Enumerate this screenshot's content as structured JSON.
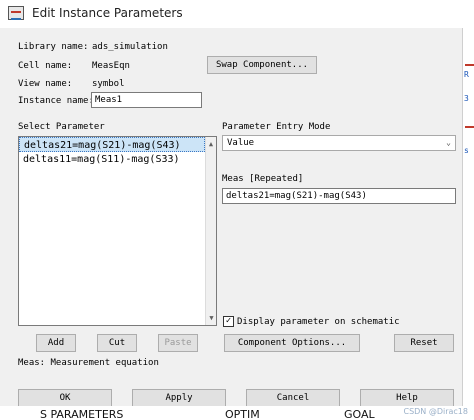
{
  "window": {
    "title": "Edit Instance Parameters",
    "icon": "ads-schematic-icon"
  },
  "info": {
    "library_label": "Library name:",
    "library_value": "ads_simulation",
    "cell_label": "Cell name:",
    "cell_value": "MeasEqn",
    "view_label": "View name:",
    "view_value": "symbol",
    "instance_label": "Instance name:",
    "instance_value": "Meas1",
    "swap_button": "Swap Component..."
  },
  "parameters": {
    "select_label": "Select Parameter",
    "items": [
      "deltas21=mag(S21)-mag(S43)",
      "deltas11=mag(S11)-mag(S33)"
    ],
    "selected_index": 0,
    "add_button": "Add",
    "cut_button": "Cut",
    "paste_button": "Paste"
  },
  "entry": {
    "mode_label": "Parameter Entry Mode",
    "mode_value": "Value",
    "meas_label": "Meas [Repeated]",
    "meas_value": "deltas21=mag(S21)-mag(S43)",
    "display_checkbox_label": "Display parameter on schematic",
    "display_checked": true,
    "component_options_button": "Component Options...",
    "reset_button": "Reset"
  },
  "description": "Meas: Measurement equation",
  "footer": {
    "ok": "OK",
    "apply": "Apply",
    "cancel": "Cancel",
    "help": "Help"
  },
  "background": {
    "strip_text": "S PARAMETERS",
    "optim_text": "OPTIM",
    "goal_text": "GOAL",
    "watermark": "CSDN @Dirac18"
  }
}
